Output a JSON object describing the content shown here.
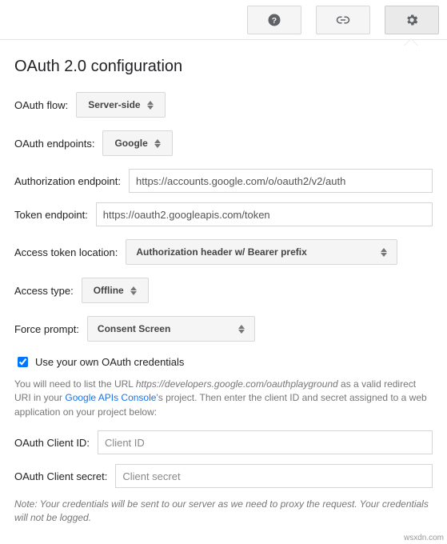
{
  "title": "OAuth 2.0 configuration",
  "oauth_flow": {
    "label": "OAuth flow:",
    "value": "Server-side"
  },
  "oauth_endpoints": {
    "label": "OAuth endpoints:",
    "value": "Google"
  },
  "auth_endpoint": {
    "label": "Authorization endpoint:",
    "value": "https://accounts.google.com/o/oauth2/v2/auth"
  },
  "token_endpoint": {
    "label": "Token endpoint:",
    "value": "https://oauth2.googleapis.com/token"
  },
  "token_location": {
    "label": "Access token location:",
    "value": "Authorization header w/ Bearer prefix"
  },
  "access_type": {
    "label": "Access type:",
    "value": "Offline"
  },
  "force_prompt": {
    "label": "Force prompt:",
    "value": "Consent Screen"
  },
  "own_creds": {
    "label": "Use your own OAuth credentials"
  },
  "help": {
    "pre": "You will need to list the URL ",
    "url": "https://developers.google.com/oauthplayground",
    "mid": " as a valid redirect URI in your ",
    "link": "Google APIs Console",
    "post": "'s project. Then enter the client ID and secret assigned to a web application on your project below:"
  },
  "client_id": {
    "label": "OAuth Client ID:",
    "placeholder": "Client ID"
  },
  "client_secret": {
    "label": "OAuth Client secret:",
    "placeholder": "Client secret"
  },
  "note": "Note: Your credentials will be sent to our server as we need to proxy the request. Your credentials will not be logged.",
  "attrib": "wsxdn.com"
}
